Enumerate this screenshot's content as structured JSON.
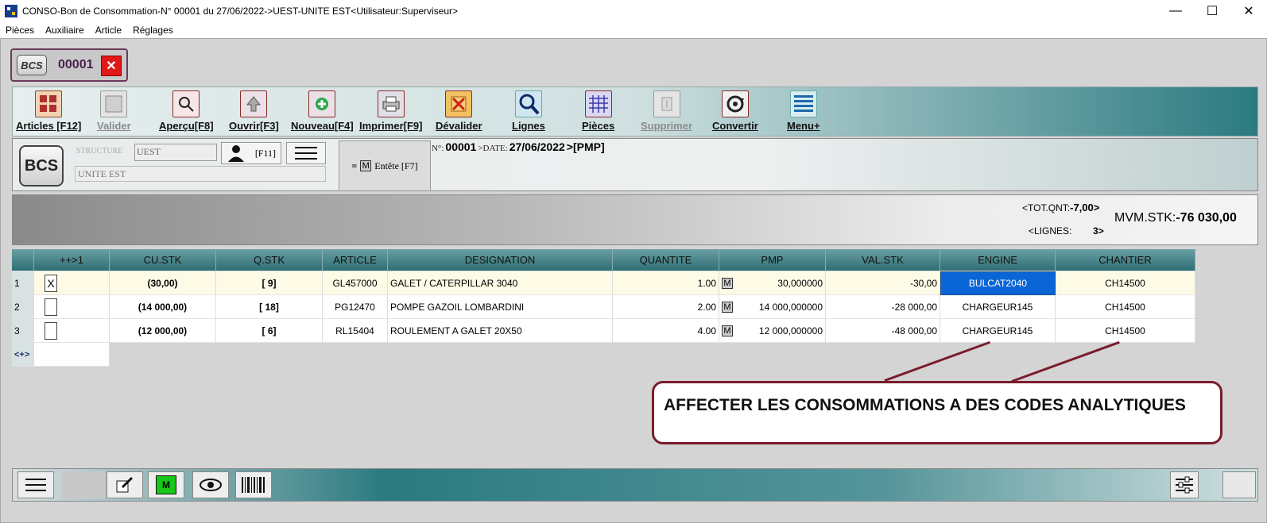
{
  "window": {
    "title": "CONSO-Bon de Consommation-N° 00001 du 27/06/2022->UEST-UNITE EST<Utilisateur:Superviseur>",
    "minimize": "—",
    "maximize": "☐",
    "close": "✕"
  },
  "menu": [
    "Pièces",
    "Auxiliaire",
    "Article",
    "Réglages"
  ],
  "doc_tab": {
    "badge": "BCS",
    "number": "00001",
    "close": "✕"
  },
  "toolbar": [
    {
      "label": "Articles [F12]",
      "icon": "articles-grid-icon",
      "enabled": true
    },
    {
      "label": "Valider",
      "icon": "validate-icon",
      "enabled": false
    },
    {
      "label": "Aperçu[F8]",
      "icon": "preview-magnifier-icon",
      "enabled": true
    },
    {
      "label": "Ouvrir[F3]",
      "icon": "open-arrow-icon",
      "enabled": true
    },
    {
      "label": "Nouveau[F4]",
      "icon": "new-plus-icon",
      "enabled": true
    },
    {
      "label": "Imprimer[F9]",
      "icon": "printer-icon",
      "enabled": true
    },
    {
      "label": "Dévalider",
      "icon": "unvalidate-cross-icon",
      "enabled": true
    },
    {
      "label": "Lignes",
      "icon": "lines-search-icon",
      "enabled": true
    },
    {
      "label": "Pièces",
      "icon": "pieces-grid-icon",
      "enabled": true
    },
    {
      "label": "Supprimer",
      "icon": "delete-icon",
      "enabled": false
    },
    {
      "label": "Convertir",
      "icon": "convert-icon",
      "enabled": true
    },
    {
      "label": "Menu+",
      "icon": "menu-lines-icon",
      "enabled": true
    }
  ],
  "header": {
    "badge": "BCS",
    "structure_label": "STRUCTURE",
    "structure_code": "UEST",
    "structure_name": "UNITE EST",
    "user_shortcut": "[F11]",
    "entete_label": "Entête [F7]",
    "entete_icon": "M",
    "num_label": "N°:",
    "num_value": "00001",
    "date_label": ">DATE:",
    "date_value": "27/06/2022",
    "method_value": ">[PMP]"
  },
  "summary": {
    "tot_qnt_label": "<TOT.QNT:",
    "tot_qnt_value": "-7,00>",
    "lignes_label": "<LIGNES:",
    "lignes_value": "3>",
    "mvm_label": "MVM.STK:",
    "mvm_value": "-76 030,00"
  },
  "grid": {
    "columns": [
      "++>1",
      "CU.STK",
      "Q.STK",
      "ARTICLE",
      "DESIGNATION",
      "QUANTITE",
      "PMP",
      "VAL.STK",
      "ENGINE",
      "CHANTIER"
    ],
    "rows": [
      {
        "num": "1",
        "check": "X",
        "cu_stk": "(30,00)",
        "q_stk": "[ 9]",
        "article": "GL457000",
        "designation": "GALET / CATERPILLAR 3040",
        "quantite": "1.00",
        "m": "M",
        "pmp": "30,000000",
        "val_stk": "-30,00",
        "engine": "BULCAT2040",
        "chantier": "CH14500"
      },
      {
        "num": "2",
        "check": "",
        "cu_stk": "(14 000,00)",
        "q_stk": "[ 18]",
        "article": "PG12470",
        "designation": "POMPE GAZOIL LOMBARDINI",
        "quantite": "2.00",
        "m": "M",
        "pmp": "14 000,000000",
        "val_stk": "-28 000,00",
        "engine": "CHARGEUR145",
        "chantier": "CH14500"
      },
      {
        "num": "3",
        "check": "",
        "cu_stk": "(12 000,00)",
        "q_stk": "[ 6]",
        "article": "RL15404",
        "designation": "ROULEMENT A GALET 20X50",
        "quantite": "4.00",
        "m": "M",
        "pmp": "12 000,000000",
        "val_stk": "-48 000,00",
        "engine": "CHARGEUR145",
        "chantier": "CH14500"
      }
    ],
    "new_row_label": "<+>"
  },
  "annotation": {
    "text": "AFFECTER LES CONSOMMATIONS A DES CODES ANALYTIQUES"
  },
  "colors": {
    "accent_teal": "#2d6f74",
    "selected_cell": "#0a66d6",
    "annotation": "#7a1c2c",
    "close_red": "#e01818"
  }
}
